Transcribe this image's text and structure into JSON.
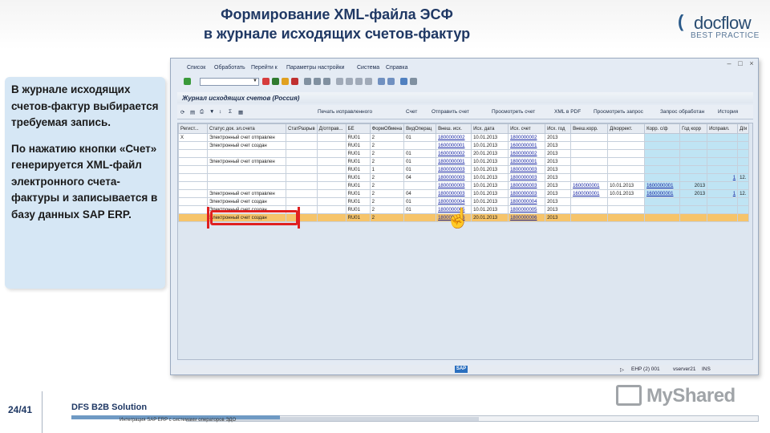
{
  "slide": {
    "title_line1": "Формирование XML-файла ЭСФ",
    "title_line2": "в журнале исходящих счетов-фактур",
    "logo_word": "docflow",
    "logo_sub": "BEST PRACTICE",
    "page_number": "24/41",
    "footer_title": "DFS B2B Solution",
    "footer_sub": "Интеграция SAP ERP с системами операторов ЭДО",
    "watermark": "MyShared"
  },
  "callout": {
    "para1": "В журнале исходящих счетов-фактур выбирается требуемая запись.",
    "para2": "По нажатию кнопки «Счет» генерируется XML-файл электронного счета-фактуры и записывается в базу данных SAP ERP."
  },
  "sap": {
    "menu": [
      "Список",
      "Обработать",
      "Перейти к",
      "Параметры настройки",
      "Система",
      "Справка"
    ],
    "journal_title": "Журнал исходящих счетов (Россия)",
    "toolbar": [
      "Печать исправленного",
      "Счет",
      "Отправить счет",
      "Просмотреть счет",
      "XML в PDF",
      "Просмотреть запрос",
      "Запрос обработан",
      "История"
    ],
    "columns": [
      "Регист...",
      "Статус док. эл.счета",
      "СтатРазрыв",
      "Д/отправ...",
      "БЕ",
      "ФормОбмена",
      "ВидОперац",
      "Внеш. исх.",
      "Исх. дата",
      "Исх. счет",
      "Исх. год",
      "Внеш.корр.",
      "Д/коррект.",
      "Корр. с/ф",
      "Год корр",
      "Исправл.",
      "Д/и"
    ],
    "rows": [
      [
        "X",
        "Электронный счет отправлен",
        "",
        "",
        "RU01",
        "2",
        "01",
        "1800000002",
        "10.01.2013",
        "1800000002",
        "2013",
        "",
        "",
        "",
        "",
        "",
        ""
      ],
      [
        "",
        "Электронный счет создан",
        "",
        "",
        "RU01",
        "2",
        "",
        "1600000001",
        "10.01.2013",
        "1600000001",
        "2013",
        "",
        "",
        "",
        "",
        "",
        ""
      ],
      [
        "",
        "",
        "",
        "",
        "RU01",
        "2",
        "01",
        "1600000002",
        "20.01.2013",
        "1600000002",
        "2013",
        "",
        "",
        "",
        "",
        "",
        ""
      ],
      [
        "",
        "Электронный счет отправлен",
        "",
        "",
        "RU01",
        "2",
        "01",
        "1800000001",
        "10.01.2013",
        "1800000001",
        "2013",
        "",
        "",
        "",
        "",
        "",
        ""
      ],
      [
        "",
        "",
        "",
        "",
        "RU01",
        "1",
        "01",
        "1800000003",
        "10.01.2013",
        "1800000003",
        "2013",
        "",
        "",
        "",
        "",
        "",
        ""
      ],
      [
        "",
        "",
        "",
        "",
        "RU01",
        "2",
        "04",
        "1800000003",
        "10.01.2013",
        "1800000003",
        "2013",
        "",
        "",
        "",
        "",
        "1",
        "12."
      ],
      [
        "",
        "",
        "",
        "",
        "RU01",
        "2",
        "",
        "1800000003",
        "10.01.2013",
        "1800000003",
        "2013",
        "1600000001",
        "10.01.2013",
        "1600000001",
        "2013",
        "",
        ""
      ],
      [
        "",
        "Электронный счет отправлен",
        "",
        "",
        "RU01",
        "2",
        "04",
        "1800000003",
        "10.01.2013",
        "1800000003",
        "2013",
        "1600000001",
        "10.01.2013",
        "1600000001",
        "2013",
        "1",
        "12."
      ],
      [
        "",
        "Электронный счет создан",
        "",
        "",
        "RU01",
        "2",
        "01",
        "1800000004",
        "10.01.2013",
        "1800000004",
        "2013",
        "",
        "",
        "",
        "",
        "",
        ""
      ],
      [
        "",
        "Электронный счет создан",
        "",
        "",
        "RU01",
        "2",
        "01",
        "1800000005",
        "10.01.2013",
        "1800000005",
        "2013",
        "",
        "",
        "",
        "",
        "",
        ""
      ],
      [
        "",
        "Электронный счет создан",
        "",
        "",
        "RU01",
        "2",
        "",
        "1800000006",
        "20.01.2013",
        "1800000006",
        "2013",
        "",
        "",
        "",
        "",
        "",
        ""
      ]
    ],
    "selected_row": 10,
    "status": {
      "sap_logo": "SAP",
      "session": "EHP (2) 001",
      "server": "vserver21",
      "mode": "INS"
    }
  }
}
